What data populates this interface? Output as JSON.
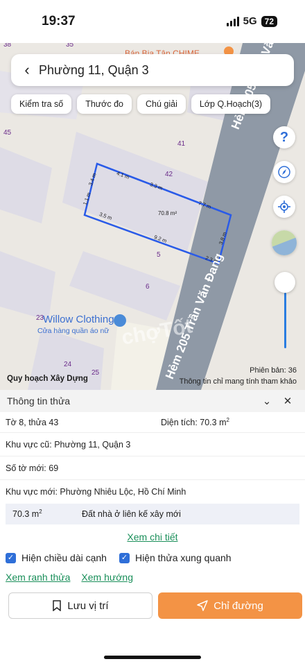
{
  "status": {
    "time": "19:37",
    "network": "5G",
    "battery": "72"
  },
  "search": {
    "title": "Phường 11, Quận 3"
  },
  "chips": [
    "Kiểm tra số",
    "Thước đo",
    "Chú giải",
    "Lớp Q.Hoạch(3)"
  ],
  "map": {
    "poi_top": "Bán Bia Tân CHIME",
    "street_label_top": "Hẻm 205 Trần Văn Đang",
    "street_label_bottom": "Hẻm 205 Trần Văn Đang",
    "shop_name": "Willow Clothing",
    "shop_desc": "Cửa hàng quần áo nữ",
    "watermark": "chợTốt",
    "parcel_numbers": [
      "38",
      "35",
      "45",
      "41",
      "42",
      "5",
      "6",
      "23",
      "24",
      "25"
    ],
    "parcel_area": "70.8 m²",
    "edges": [
      "4.1 m",
      "3.3 m",
      "7.7 m",
      "3.8 m",
      "3.4 m",
      "1.1 m",
      "3.5 m",
      "9.2 m",
      "2.3 m"
    ],
    "bottom_left_label": "Quy hoạch Xây Dựng",
    "version": "Phiên bản: 36",
    "note": "Thông tin chỉ mang tính tham khảo"
  },
  "panel": {
    "title": "Thông tin thửa",
    "sheet": "Tờ 8, thửa 43",
    "area_label": "Diện tích: 70.3 m",
    "area_sup": "2",
    "old_area": "Khu vực cũ: Phường 11, Quận 3",
    "new_sheet": "Số tờ mới: 69",
    "new_area": "Khu vực mới: Phường Nhiêu Lộc, Hồ Chí Minh",
    "landuse_area": "70.3 m",
    "landuse_sup": "2",
    "landuse_type": "Đất nhà ở liên kế xây mới",
    "detail_link": "Xem chi tiết",
    "check_edges": "Hiện chiều dài cạnh",
    "check_neighbors": "Hiện thửa xung quanh",
    "link_boundary": "Xem ranh thửa",
    "link_direction": "Xem hướng",
    "save_label": "Lưu vị trí",
    "directions_label": "Chỉ đường"
  },
  "colors": {
    "accent": "#f39345",
    "link": "#1a8f5a",
    "parcel": "#2a5be8",
    "road": "#8f99a6"
  }
}
